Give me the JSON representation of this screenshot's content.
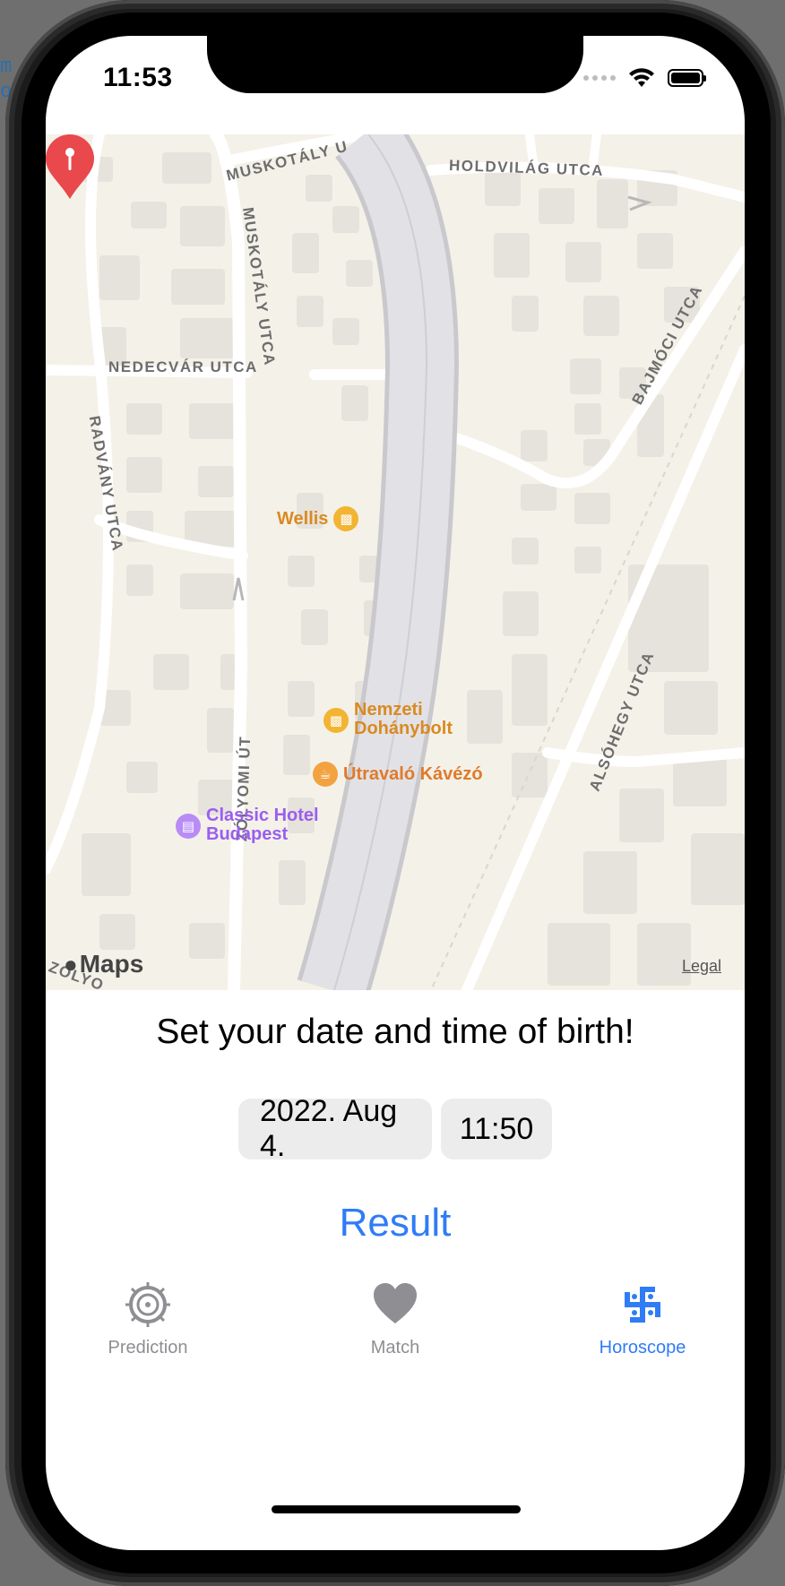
{
  "status": {
    "time": "11:53"
  },
  "map": {
    "streets": {
      "muskotaly_top": "MUSKOTÁLY U",
      "holdvilag": "HOLDVILÁG UTCA",
      "muskotaly_vertical": "MUSKOTÁLY UTCA",
      "nedecvar": "NEDECVÁR UTCA",
      "radvany": "RADVÁNY UTCA",
      "bajmoci": "BAJMÓCI UTCA",
      "zolyomi": "ZÓLYOMI ÚT",
      "alsohegy": "ALSÓHEGY UTCA",
      "zolyo_bottom": "ZÓLYO"
    },
    "pois": [
      {
        "name": "Wellis",
        "icon": "shopping-bag-icon",
        "color": "#e08a1a"
      },
      {
        "name": "Nemzeti Dohánybolt",
        "line1": "Nemzeti",
        "line2": "Dohánybolt",
        "icon": "shopping-bag-icon",
        "color": "#e08a1a"
      },
      {
        "name": "Útravaló Kávézó",
        "icon": "coffee-cup-icon",
        "color": "#e07a2a"
      },
      {
        "name": "Classic Hotel Budapest",
        "line1": "Classic Hotel",
        "line2": "Budapest",
        "icon": "bed-icon",
        "color": "#9a5ef0"
      }
    ],
    "attribution": "Maps",
    "legal": "Legal"
  },
  "form": {
    "prompt": "Set your date and time of birth!",
    "date": "2022. Aug 4.",
    "time": "11:50",
    "submit": "Result"
  },
  "tabs": [
    {
      "label": "Prediction",
      "icon": "compass-icon",
      "active": false
    },
    {
      "label": "Match",
      "icon": "heart-icon",
      "active": false
    },
    {
      "label": "Horoscope",
      "icon": "swastika-symbol-icon",
      "active": true
    }
  ],
  "colors": {
    "accent": "#2f7cf6",
    "inactive": "#8e8e93",
    "pin": "#e9494c"
  }
}
